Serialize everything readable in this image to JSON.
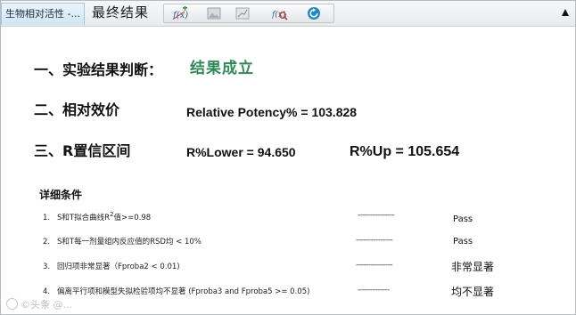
{
  "tabs": [
    {
      "label": "生物相对活性 -..."
    },
    {
      "label": "最终结果"
    }
  ],
  "toolbar": {
    "tools": [
      {
        "icon": "fx-add-icon"
      },
      {
        "icon": "image-icon"
      },
      {
        "icon": "line-chart-icon"
      },
      {
        "icon": "fx-search-icon"
      },
      {
        "icon": "refresh-icon"
      }
    ]
  },
  "sections": {
    "s1_label": "一、实验结果判断：",
    "s1_verdict": "结果成立",
    "s2_label": "二、相对效价",
    "s2_value": "Relative Potency% = 103.828",
    "s3_label": "三、R置信区间",
    "s3_lower": "R%Lower = 94.650",
    "s3_upper": "R%Up = 105.654"
  },
  "details": {
    "title": "详细条件",
    "conditions": [
      {
        "num": "1.",
        "text": "S和T拟合曲线R",
        "sup": "2",
        "text2": "值>=0.98",
        "dash": "---------------",
        "result": "Pass"
      },
      {
        "num": "2.",
        "text": "S和T每一剂量组内反应值的RSD均 <   10%",
        "dash": "---------------",
        "result": "Pass"
      },
      {
        "num": "3.",
        "text": "回归项非常显著（Fproba2 < 0.01)",
        "dash": "---------------",
        "result": "非常显著"
      },
      {
        "num": "4.",
        "text": "偏离平行项和模型失拟检验项均不显著 (Fproba3 and Fproba5 >= 0.05)",
        "dash": "-------------",
        "result": "均不显著"
      }
    ]
  },
  "watermark": "©头条 @...",
  "colors": {
    "verdict": "#2e8b57"
  }
}
